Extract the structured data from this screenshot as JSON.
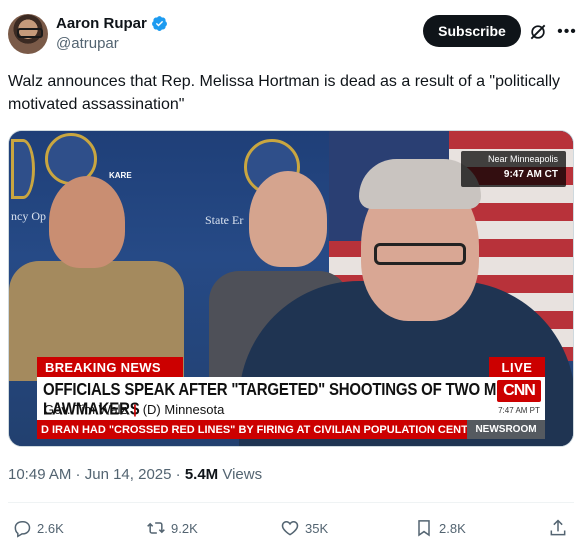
{
  "author": {
    "display_name": "Aaron Rupar",
    "handle": "@atrupar",
    "verified_icon": "verified-badge-icon",
    "accent_color": "#1d9bf0"
  },
  "header_actions": {
    "subscribe_label": "Subscribe",
    "grok_icon": "grok-icon",
    "more_icon": "more-icon"
  },
  "tweet": {
    "text": "Walz announces that Rep. Melissa Hortman is dead as a result of a \"politically motivated assassination\""
  },
  "media": {
    "kare_label": "KARE",
    "wall_text_left": "ncy Op",
    "wall_text_right": "State Er",
    "location": "Near Minneapolis",
    "location_time": "9:47 AM CT",
    "breaking_label": "BREAKING NEWS",
    "live_label": "LIVE",
    "headline": "OFFICIALS SPEAK AFTER \"TARGETED\" SHOOTINGS OF TWO MN LAWMAKERS",
    "speaker_name": "Gov. Tim Walz",
    "speaker_affiliation": "(D) Minnesota",
    "network_logo": "CNN",
    "network_time": "7:47 AM PT",
    "ticker": "D IRAN HAD \"CROSSED RED LINES\" BY FIRING AT CIVILIAN POPULATION CENTERS, WHI",
    "ticker_tag": "NEWSROOM"
  },
  "meta": {
    "time": "10:49 AM",
    "dot": " · ",
    "date": "Jun 14, 2025",
    "views_count": "5.4M",
    "views_label": " Views"
  },
  "actions": {
    "replies": "2.6K",
    "reposts": "9.2K",
    "likes": "35K",
    "bookmarks": "2.8K"
  }
}
